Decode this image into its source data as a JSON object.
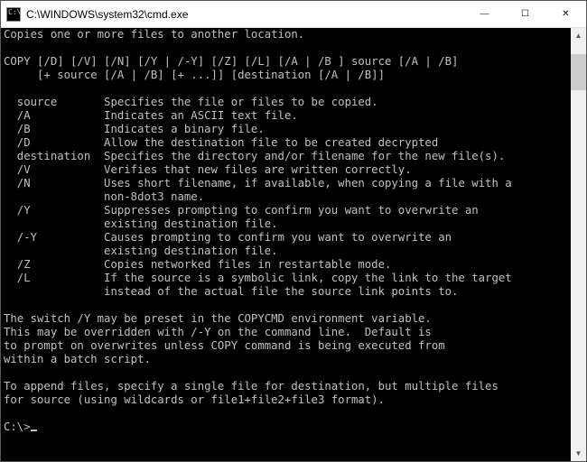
{
  "titlebar": {
    "icon_glyph": "C:\\",
    "title": "C:\\WINDOWS\\system32\\cmd.exe",
    "min_symbol": "—",
    "max_symbol": "☐",
    "close_symbol": "✕"
  },
  "help": {
    "intro": "Copies one or more files to another location.",
    "syntax1": "COPY [/D] [/V] [/N] [/Y | /-Y] [/Z] [/L] [/A | /B ] source [/A | /B]",
    "syntax2": "     [+ source [/A | /B] [+ ...]] [destination [/A | /B]]",
    "params": [
      {
        "name": "  source     ",
        "desc1": "Specifies the file or files to be copied.",
        "desc2": ""
      },
      {
        "name": "  /A         ",
        "desc1": "Indicates an ASCII text file.",
        "desc2": ""
      },
      {
        "name": "  /B         ",
        "desc1": "Indicates a binary file.",
        "desc2": ""
      },
      {
        "name": "  /D         ",
        "desc1": "Allow the destination file to be created decrypted",
        "desc2": ""
      },
      {
        "name": "  destination",
        "desc1": "Specifies the directory and/or filename for the new file(s).",
        "desc2": ""
      },
      {
        "name": "  /V         ",
        "desc1": "Verifies that new files are written correctly.",
        "desc2": ""
      },
      {
        "name": "  /N         ",
        "desc1": "Uses short filename, if available, when copying a file with a",
        "desc2": "non-8dot3 name."
      },
      {
        "name": "  /Y         ",
        "desc1": "Suppresses prompting to confirm you want to overwrite an",
        "desc2": "existing destination file."
      },
      {
        "name": "  /-Y        ",
        "desc1": "Causes prompting to confirm you want to overwrite an",
        "desc2": "existing destination file."
      },
      {
        "name": "  /Z         ",
        "desc1": "Copies networked files in restartable mode.",
        "desc2": ""
      },
      {
        "name": "  /L         ",
        "desc1": "If the source is a symbolic link, copy the link to the target",
        "desc2": "instead of the actual file the source link points to."
      }
    ],
    "note1": "The switch /Y may be preset in the COPYCMD environment variable.",
    "note2": "This may be overridden with /-Y on the command line.  Default is",
    "note3": "to prompt on overwrites unless COPY command is being executed from",
    "note4": "within a batch script.",
    "append1": "To append files, specify a single file for destination, but multiple files",
    "append2": "for source (using wildcards or file1+file2+file3 format).",
    "prompt": "C:\\>"
  }
}
